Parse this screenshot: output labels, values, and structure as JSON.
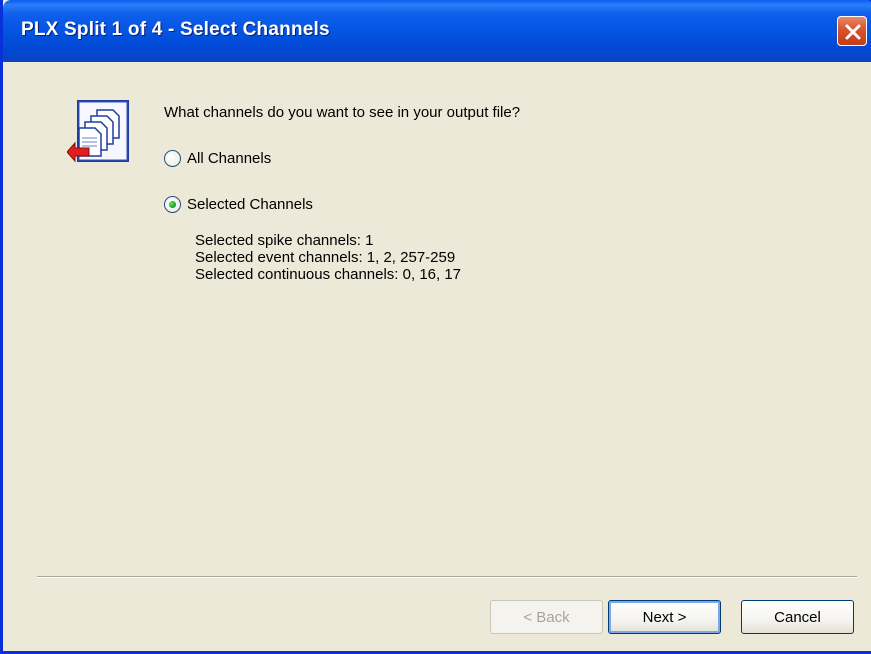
{
  "window": {
    "title": "PLX Split 1 of 4 - Select Channels",
    "close_icon": "close-icon"
  },
  "content": {
    "question": "What channels do you want to see in your output file?",
    "radio_all": "All Channels",
    "radio_selected": "Selected Channels",
    "selected_option": "Selected Channels",
    "details": [
      "Selected spike channels: 1",
      "Selected event channels: 1, 2, 257-259",
      "Selected continuous channels: 0, 16, 17"
    ],
    "icon": "wizard-documents-icon"
  },
  "buttons": {
    "back": "< Back",
    "next": "Next >",
    "cancel": "Cancel"
  },
  "colors": {
    "titlebar": "#0352e0",
    "face": "#ece9d8",
    "close_button": "#d8542e"
  }
}
